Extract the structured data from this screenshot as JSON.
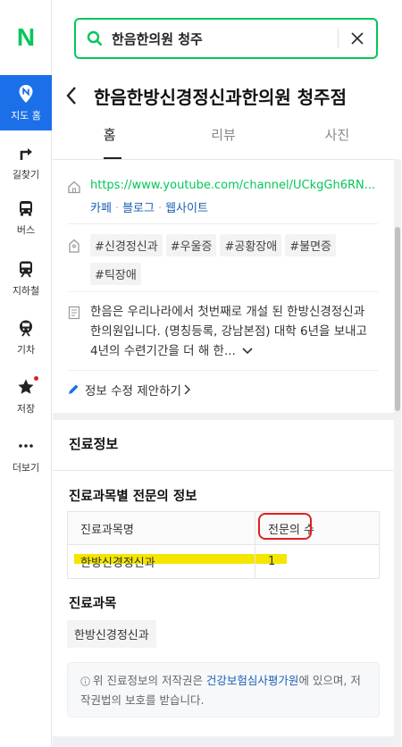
{
  "nav": {
    "logo": "N",
    "items": [
      {
        "label": "지도 홈",
        "icon": "map-pin-icon",
        "active": true
      },
      {
        "label": "길찾기",
        "icon": "directions-icon"
      },
      {
        "label": "버스",
        "icon": "bus-icon"
      },
      {
        "label": "지하철",
        "icon": "subway-icon"
      },
      {
        "label": "기차",
        "icon": "train-icon"
      },
      {
        "label": "저장",
        "icon": "star-icon"
      },
      {
        "label": "더보기",
        "icon": "more-icon"
      }
    ]
  },
  "search": {
    "query": "한음한의원 청주",
    "icon": "search-icon",
    "clear_icon": "close-icon"
  },
  "place": {
    "title": "한음한방신경정신과한의원 청주점"
  },
  "tabs": [
    {
      "label": "홈"
    },
    {
      "label": "리뷰"
    },
    {
      "label": "사진"
    }
  ],
  "info": {
    "homepage": "https://www.youtube.com/channel/UCkgGh6RN...",
    "links": [
      "카페",
      "블로그",
      "웹사이트"
    ],
    "tags": [
      "#신경정신과",
      "#우울증",
      "#공황장애",
      "#불면증",
      "#틱장애"
    ],
    "description": "한음은 우리나라에서 첫번째로 개설 된 한방신경정신과 한의원입니다. (명칭등록, 강남본점) 대학 6년을 보내고 4년의 수련기간을 더 해 한...",
    "edit_label": "정보 수정 제안하기"
  },
  "medical": {
    "section_title": "진료정보",
    "specialist_title": "진료과목별 전문의 정보",
    "table": {
      "headers": [
        "진료과목명",
        "전문의 수"
      ],
      "rows": [
        {
          "subject": "한방신경정신과",
          "count": "1"
        }
      ]
    },
    "subjects_title": "진료과목",
    "subjects": [
      "한방신경정신과"
    ],
    "notice_pre": "위 진료정보의 저작권은 ",
    "notice_em": "건강보험심사평가원",
    "notice_post": "에 있으며, 저작권법의 보호를 받습니다."
  },
  "colors": {
    "brand": "#03c75a",
    "nav_active": "#1b6fe8",
    "highlight": "#f5e600",
    "annotation": "#e02020"
  }
}
